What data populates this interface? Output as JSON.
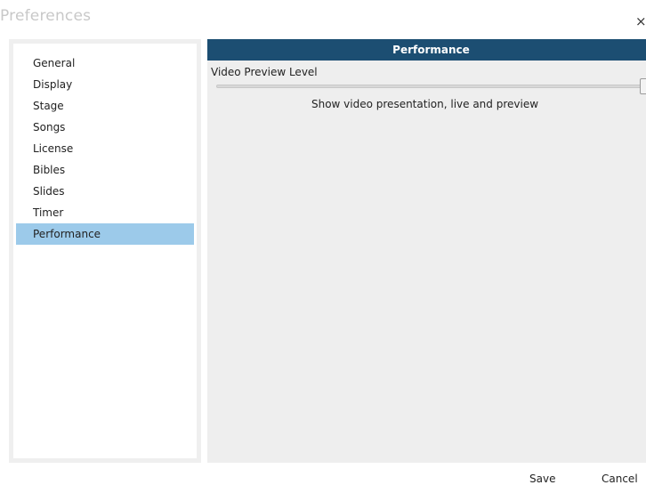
{
  "window": {
    "title": "Preferences",
    "close_glyph": "×"
  },
  "sidebar": {
    "items": [
      {
        "label": "General"
      },
      {
        "label": "Display"
      },
      {
        "label": "Stage"
      },
      {
        "label": "Songs"
      },
      {
        "label": "License"
      },
      {
        "label": "Bibles"
      },
      {
        "label": "Slides"
      },
      {
        "label": "Timer"
      },
      {
        "label": "Performance"
      }
    ],
    "selected": "Performance"
  },
  "panel": {
    "title": "Performance",
    "setting_label": "Video Preview Level",
    "slider_value": 1.0,
    "slider_caption": "Show video presentation, live and preview"
  },
  "footer": {
    "save_label": "Save",
    "cancel_label": "Cancel"
  },
  "colors": {
    "header_bg": "#1c4e72",
    "selected_bg": "#9ccaea",
    "panel_bg": "#eeeeee",
    "title_text": "#c8c8c8"
  },
  "icons": {
    "close": "close-icon"
  }
}
